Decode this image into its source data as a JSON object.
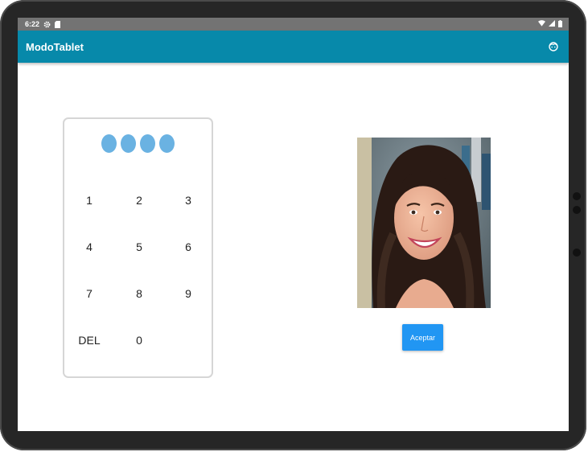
{
  "status_bar": {
    "time": "6:22",
    "icons": [
      "settings-icon",
      "sd-card-icon",
      "wifi-icon",
      "signal-icon",
      "battery-icon"
    ]
  },
  "app_bar": {
    "title": "ModoTablet",
    "action_icon": "face-icon",
    "color": "#0789aa"
  },
  "keypad": {
    "pin_dots_filled": 4,
    "pin_dot_color": "#6ab2e2",
    "keys": [
      "1",
      "2",
      "3",
      "4",
      "5",
      "6",
      "7",
      "8",
      "9",
      "DEL",
      "0"
    ]
  },
  "profile": {
    "photo_icon": "user-photo"
  },
  "actions": {
    "accept_label": "Aceptar",
    "accept_color": "#2196f3"
  }
}
